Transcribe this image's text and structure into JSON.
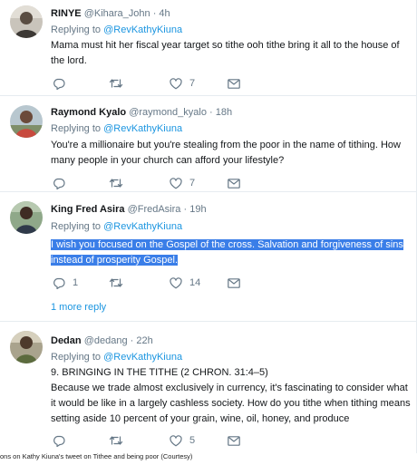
{
  "tweets": [
    {
      "name": "RINYE",
      "handle": "@Kihara_John",
      "time": "· 4h",
      "replying": "Replying to",
      "reply_handle": "@RevKathyKiuna",
      "text": "Mama must hit her fiscal year target so tithe ooh tithe bring it all to the house of the lord.",
      "reply_count": "",
      "retweet_count": "",
      "like_count": "7"
    },
    {
      "name": "Raymond Kyalo",
      "handle": "@raymond_kyalo",
      "time": "· 18h",
      "replying": "Replying to",
      "reply_handle": "@RevKathyKiuna",
      "text": "You're a millionaire but you're stealing from the poor in the name of tithing. How many people in your church can afford your lifestyle?",
      "reply_count": "",
      "retweet_count": "",
      "like_count": "7"
    },
    {
      "name": "King Fred Asira",
      "handle": "@FredAsira",
      "time": "· 19h",
      "replying": "Replying to",
      "reply_handle": "@RevKathyKiuna",
      "text": "I wish you focused on the Gospel of the cross. Salvation and forgiveness of sins instead of prosperity Gospel.",
      "reply_count": "1",
      "retweet_count": "",
      "like_count": "14",
      "more_replies": "1 more reply"
    },
    {
      "name": "Dedan",
      "handle": "@dedang",
      "time": "· 22h",
      "replying": "Replying to",
      "reply_handle": "@RevKathyKiuna",
      "text_title": "9. BRINGING IN THE TITHE (2 CHRON. 31:4–5)",
      "text": "Because we trade almost exclusively in currency, it's fascinating to consider what it would be like in a largely cashless society. How do you tithe when tithing means setting aside 10 percent of your grain, wine, oil, honey, and produce",
      "reply_count": "",
      "retweet_count": "",
      "like_count": "5"
    }
  ],
  "caption": "ons on Kathy Kiuna's tweet on Tithee and being poor (Courtesy)",
  "icons": {
    "reply": "reply-icon",
    "retweet": "retweet-icon",
    "like": "heart-icon",
    "dm": "envelope-icon"
  },
  "colors": {
    "link": "#1b95e0",
    "muted": "#657786",
    "text": "#14171a",
    "highlight": "#3a7ee8"
  }
}
